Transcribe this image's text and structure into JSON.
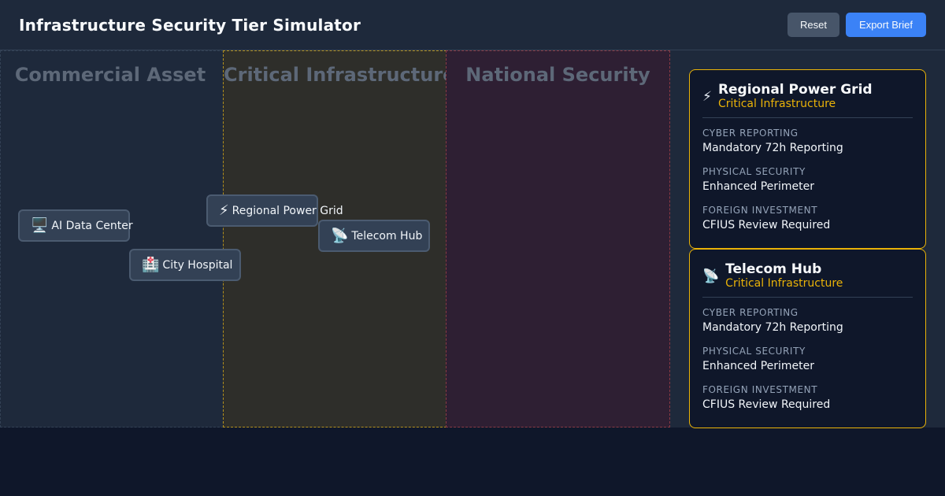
{
  "app": {
    "title": "Infrastructure Security Tier Simulator"
  },
  "toolbar": {
    "reset_label": "Reset",
    "export_label": "Export Brief"
  },
  "zones": [
    {
      "label": "Commercial Asset",
      "color": "#1e293b"
    },
    {
      "label": "Critical Infrastructure",
      "color": "#2e2e2a"
    },
    {
      "label": "National Security",
      "color": "#2e1f33"
    }
  ],
  "assets": [
    {
      "icon": "🖥️",
      "icon_name": "computer-icon",
      "label": "AI Data Center",
      "zone": "Commercial Asset"
    },
    {
      "icon": "🏥",
      "icon_name": "hospital-icon",
      "label": "City Hospital",
      "zone": "Commercial Asset"
    },
    {
      "icon": "⚡",
      "icon_name": "lightning-icon",
      "label": "Regional Power Grid",
      "zone": "Critical Infrastructure"
    },
    {
      "icon": "📡",
      "icon_name": "satellite-dish-icon",
      "label": "Telecom Hub",
      "zone": "Critical Infrastructure"
    }
  ],
  "details": [
    {
      "icon": "⚡",
      "title": "Regional Power Grid",
      "tier": "Critical Infrastructure",
      "fields": [
        {
          "label": "CYBER REPORTING",
          "value": "Mandatory 72h Reporting"
        },
        {
          "label": "PHYSICAL SECURITY",
          "value": "Enhanced Perimeter"
        },
        {
          "label": "FOREIGN INVESTMENT",
          "value": "CFIUS Review Required"
        }
      ]
    },
    {
      "icon": "📡",
      "title": "Telecom Hub",
      "tier": "Critical Infrastructure",
      "fields": [
        {
          "label": "CYBER REPORTING",
          "value": "Mandatory 72h Reporting"
        },
        {
          "label": "PHYSICAL SECURITY",
          "value": "Enhanced Perimeter"
        },
        {
          "label": "FOREIGN INVESTMENT",
          "value": "CFIUS Review Required"
        }
      ]
    }
  ],
  "colors": {
    "accent": "#3b82f6",
    "tier_critical": "#eab308",
    "background": "#0f172a"
  }
}
